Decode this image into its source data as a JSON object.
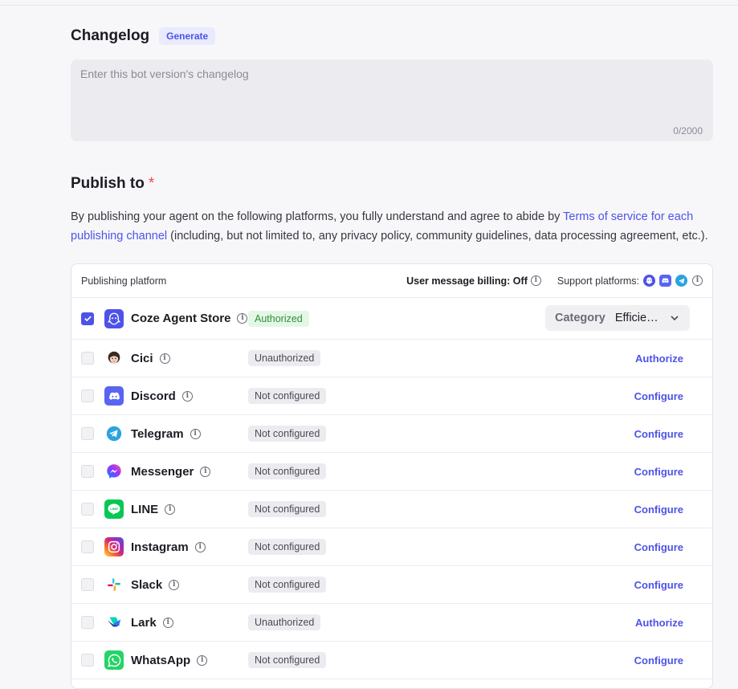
{
  "changelog": {
    "title": "Changelog",
    "generate_label": "Generate",
    "placeholder": "Enter this bot version's changelog",
    "counter": "0/2000"
  },
  "publish": {
    "title": "Publish to",
    "required_mark": "*",
    "desc_before": "By publishing your agent on the following platforms, you fully understand and agree to abide by ",
    "desc_link": "Terms of service for each publishing channel",
    "desc_after": " (including, but not limited to, any privacy policy, community guidelines, data processing agreement, etc.)."
  },
  "table": {
    "col_platform": "Publishing platform",
    "billing_label": "User message billing: Off",
    "support_label": "Support platforms:"
  },
  "category": {
    "label": "Category",
    "value": "Efficie…"
  },
  "platforms": [
    {
      "name": "Coze Agent Store",
      "status": "Authorized",
      "checked": true,
      "icon": "coze-icon",
      "color": "#4d53e8"
    },
    {
      "name": "Cici",
      "status": "Unauthorized",
      "action": "Authorize",
      "icon": "cici-icon",
      "color": "#ffffff"
    },
    {
      "name": "Discord",
      "status": "Not configured",
      "action": "Configure",
      "icon": "discord-icon",
      "color": "#5865f2"
    },
    {
      "name": "Telegram",
      "status": "Not configured",
      "action": "Configure",
      "icon": "telegram-icon",
      "color": "#2aa3df"
    },
    {
      "name": "Messenger",
      "status": "Not configured",
      "action": "Configure",
      "icon": "messenger-icon",
      "color": "#a033ff"
    },
    {
      "name": "LINE",
      "status": "Not configured",
      "action": "Configure",
      "icon": "line-icon",
      "color": "#06c755"
    },
    {
      "name": "Instagram",
      "status": "Not configured",
      "action": "Configure",
      "icon": "instagram-icon",
      "color": "#e1306c"
    },
    {
      "name": "Slack",
      "status": "Not configured",
      "action": "Configure",
      "icon": "slack-icon",
      "color": "#ffffff"
    },
    {
      "name": "Lark",
      "status": "Unauthorized",
      "action": "Authorize",
      "icon": "lark-icon",
      "color": "#ffffff"
    },
    {
      "name": "WhatsApp",
      "status": "Not configured",
      "action": "Configure",
      "icon": "whatsapp-icon",
      "color": "#25d366"
    }
  ]
}
